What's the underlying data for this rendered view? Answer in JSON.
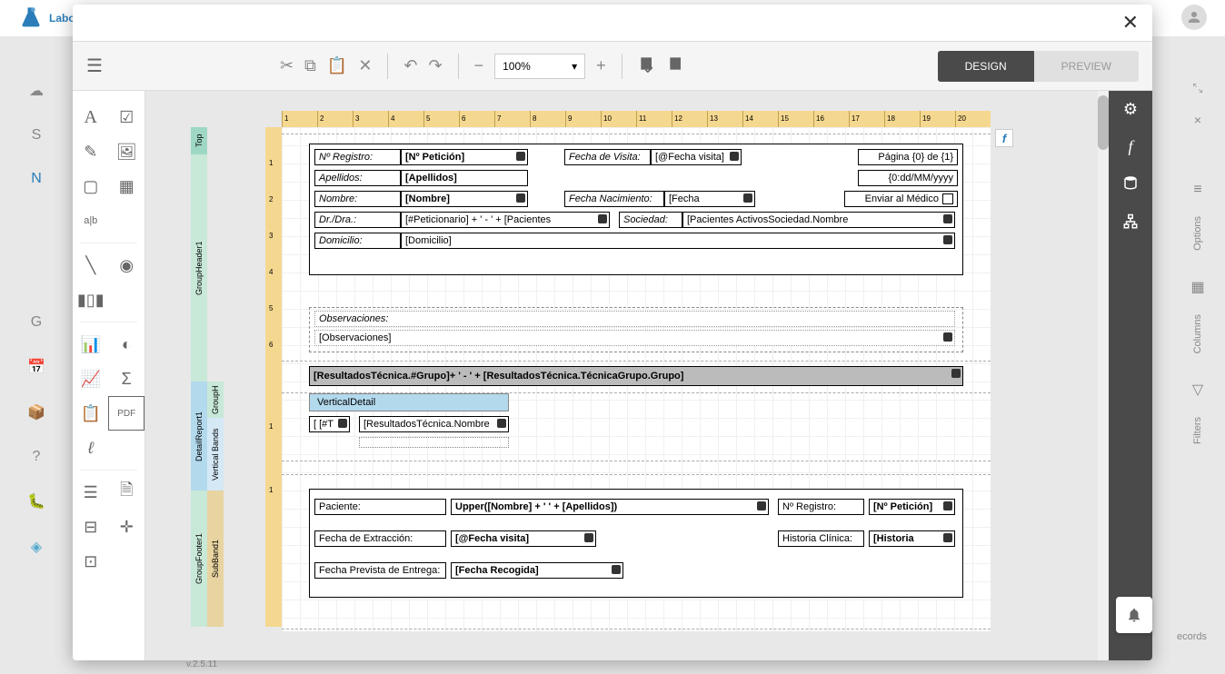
{
  "app": {
    "name": "Laboratorio",
    "version": "v.2.5.11"
  },
  "toolbar": {
    "zoom": "100%",
    "design_label": "DESIGN",
    "preview_label": "PREVIEW"
  },
  "ruler_ticks": [
    "1",
    "2",
    "3",
    "4",
    "5",
    "6",
    "7",
    "8",
    "9",
    "10",
    "11",
    "12",
    "13",
    "14",
    "15",
    "16",
    "17",
    "18",
    "19",
    "20"
  ],
  "bands": {
    "top": "Top",
    "gh1": "GroupHeader1",
    "gh2": "GroupH",
    "dr": "DetailReport1",
    "vb": "Vertical Bands",
    "gf": "GroupFooter1",
    "sb": "SubBand1"
  },
  "report": {
    "header": {
      "registro_label": "Nº Registro:",
      "registro_value": "[Nº Petición]",
      "fecha_visita_label": "Fecha de Visita:",
      "fecha_visita_value": "[@Fecha visita]",
      "pagina": "Página {0} de {1}",
      "apellidos_label": "Apellidos:",
      "apellidos_value": "[Apellidos]",
      "fecha_fmt": "{0:dd/MM/yyyy",
      "nombre_label": "Nombre:",
      "nombre_value": "[Nombre]",
      "fecha_nac_label": "Fecha Nacimiento:",
      "fecha_nac_value": "[Fecha",
      "enviar_medico": "Enviar al Médico",
      "dr_label": "Dr./Dra.:",
      "dr_value": "[#Peticionario] + ' - ' + [Pacientes",
      "sociedad_label": "Sociedad:",
      "sociedad_value": "[Pacientes ActivosSociedad.Nombre",
      "domicilio_label": "Domicilio:",
      "domicilio_value": "[Domicilio]"
    },
    "observaciones": {
      "label": "Observaciones:",
      "value": "[Observaciones]"
    },
    "grupo": "[ResultadosTécnica.#Grupo]+ ' - ' + [ResultadosTécnica.TécnicaGrupo.Grupo]",
    "vdetail_label": "VerticalDetail",
    "detail": {
      "t": "[ [#T",
      "nombre": "[ResultadosTécnica.Nombre"
    },
    "footer": {
      "paciente_label": "Paciente:",
      "paciente_value": "Upper([Nombre] + ' ' + [Apellidos])",
      "registro_label": "Nº Registro:",
      "registro_value": "[Nº Petición]",
      "extraccion_label": "Fecha de Extracción:",
      "extraccion_value": "[@Fecha visita]",
      "historia_label": "Historia Clínica:",
      "historia_value": "[Historia",
      "entrega_label": "Fecha Prevista de Entrega:",
      "entrega_value": "[Fecha Recogida]"
    }
  },
  "bg_sidebar": {
    "options": "Options",
    "columns": "Columns",
    "filters": "Filters",
    "records": "ecords"
  },
  "fx": "f"
}
